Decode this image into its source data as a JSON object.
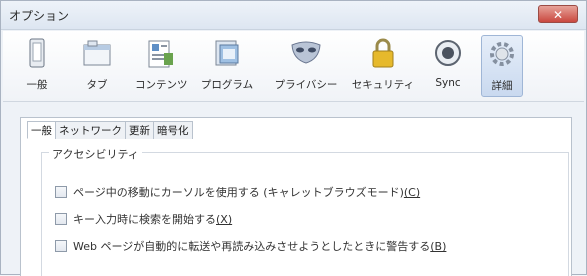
{
  "window": {
    "title": "オプション",
    "close_label": "✕"
  },
  "toolbar": [
    {
      "key": "general",
      "label": "一般",
      "icon": "device-icon"
    },
    {
      "key": "tabs",
      "label": "タブ",
      "icon": "tab-window-icon"
    },
    {
      "key": "content",
      "label": "コンテンツ",
      "icon": "content-icon"
    },
    {
      "key": "programs",
      "label": "プログラム",
      "icon": "programs-icon"
    },
    {
      "key": "privacy",
      "label": "プライバシー",
      "icon": "mask-icon"
    },
    {
      "key": "security",
      "label": "セキュリティ",
      "icon": "padlock-icon"
    },
    {
      "key": "sync",
      "label": "Sync",
      "icon": "sync-icon"
    },
    {
      "key": "advanced",
      "label": "詳細",
      "icon": "gear-icon",
      "selected": true
    }
  ],
  "subtabs": [
    {
      "label": "一般",
      "active": true
    },
    {
      "label": "ネットワーク"
    },
    {
      "label": "更新"
    },
    {
      "label": "暗号化"
    }
  ],
  "accessibility": {
    "legend": "アクセシビリティ",
    "options": [
      {
        "text": "ページ中の移動にカーソルを使用する (キャレットブラウズモード)",
        "hotkey": "(C)",
        "checked": false
      },
      {
        "text": "キー入力時に検索を開始する",
        "hotkey": "(X)",
        "checked": false
      },
      {
        "text": "Web ページが自動的に転送や再読み込みさせようとしたときに警告する",
        "hotkey": "(B)",
        "checked": false
      }
    ]
  }
}
